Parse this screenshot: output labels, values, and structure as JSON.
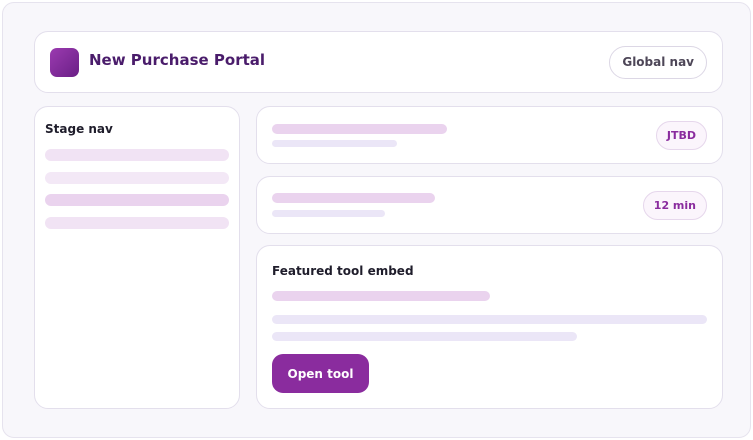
{
  "header": {
    "title": "New Purchase Portal",
    "global_nav_label": "Global nav"
  },
  "sidebar": {
    "title": "Stage nav",
    "item_count_visible": 4
  },
  "rows": [
    {
      "badge": "JTBD"
    },
    {
      "badge": "12 min"
    }
  ],
  "featured": {
    "title": "Featured tool embed",
    "button_label": "Open tool"
  },
  "colors": {
    "accent": "#8a2c9e",
    "brand_dark": "#4a1c6b",
    "skeleton_pink": "#ead3ee",
    "skeleton_lavender": "#ebe6f7",
    "background": "#f8f7fb"
  },
  "icons": {
    "logo": "app-logo-square"
  }
}
